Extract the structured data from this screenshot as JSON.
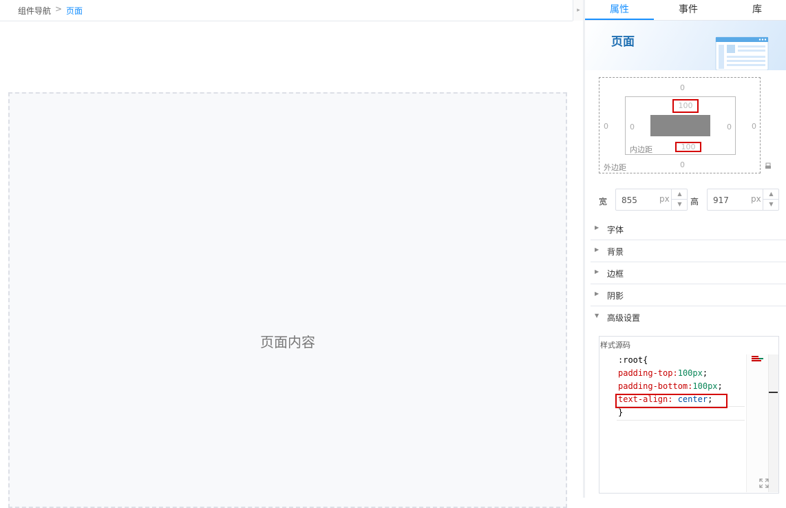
{
  "breadcrumb": {
    "root": "组件导航",
    "separator": ">",
    "current": "页面"
  },
  "collapse_icon": "chevron-right-icon",
  "canvas": {
    "placeholder": "页面内容"
  },
  "tabs": [
    {
      "label": "属性",
      "active": true
    },
    {
      "label": "事件",
      "active": false
    },
    {
      "label": "库",
      "active": false
    }
  ],
  "banner": {
    "title": "页面",
    "illustration": "page-illustration-icon"
  },
  "box_model": {
    "margin": {
      "top": "0",
      "right": "0",
      "bottom": "0",
      "left": "0"
    },
    "margin_label": "外边距",
    "padding": {
      "top": "100",
      "right": "0",
      "bottom": "100",
      "left": "0"
    },
    "padding_label": "内边距",
    "lock_icon": "link-icon"
  },
  "size": {
    "width_label": "宽",
    "width_value": "855",
    "height_label": "高",
    "height_value": "917",
    "unit": "px"
  },
  "sections": [
    {
      "label": "字体",
      "expanded": false
    },
    {
      "label": "背景",
      "expanded": false
    },
    {
      "label": "边框",
      "expanded": false
    },
    {
      "label": "阴影",
      "expanded": false
    },
    {
      "label": "高级设置",
      "expanded": true
    }
  ],
  "code_editor": {
    "caption": "样式源码",
    "lines": [
      {
        "selector": ":root",
        "open": "{"
      },
      {
        "prop": "padding-top",
        "colon": ":",
        "value": "100px",
        "semi": ";"
      },
      {
        "prop": "padding-bottom",
        "colon": ":",
        "value": "100px",
        "semi": ";"
      },
      {
        "prop": "text-align",
        "colon": ": ",
        "value": "center",
        "semi": ";"
      },
      {
        "close": "}"
      }
    ],
    "expand_icon": "fullscreen-icon"
  },
  "colors": {
    "accent": "#1890ff",
    "highlight_border": "#d40000"
  }
}
